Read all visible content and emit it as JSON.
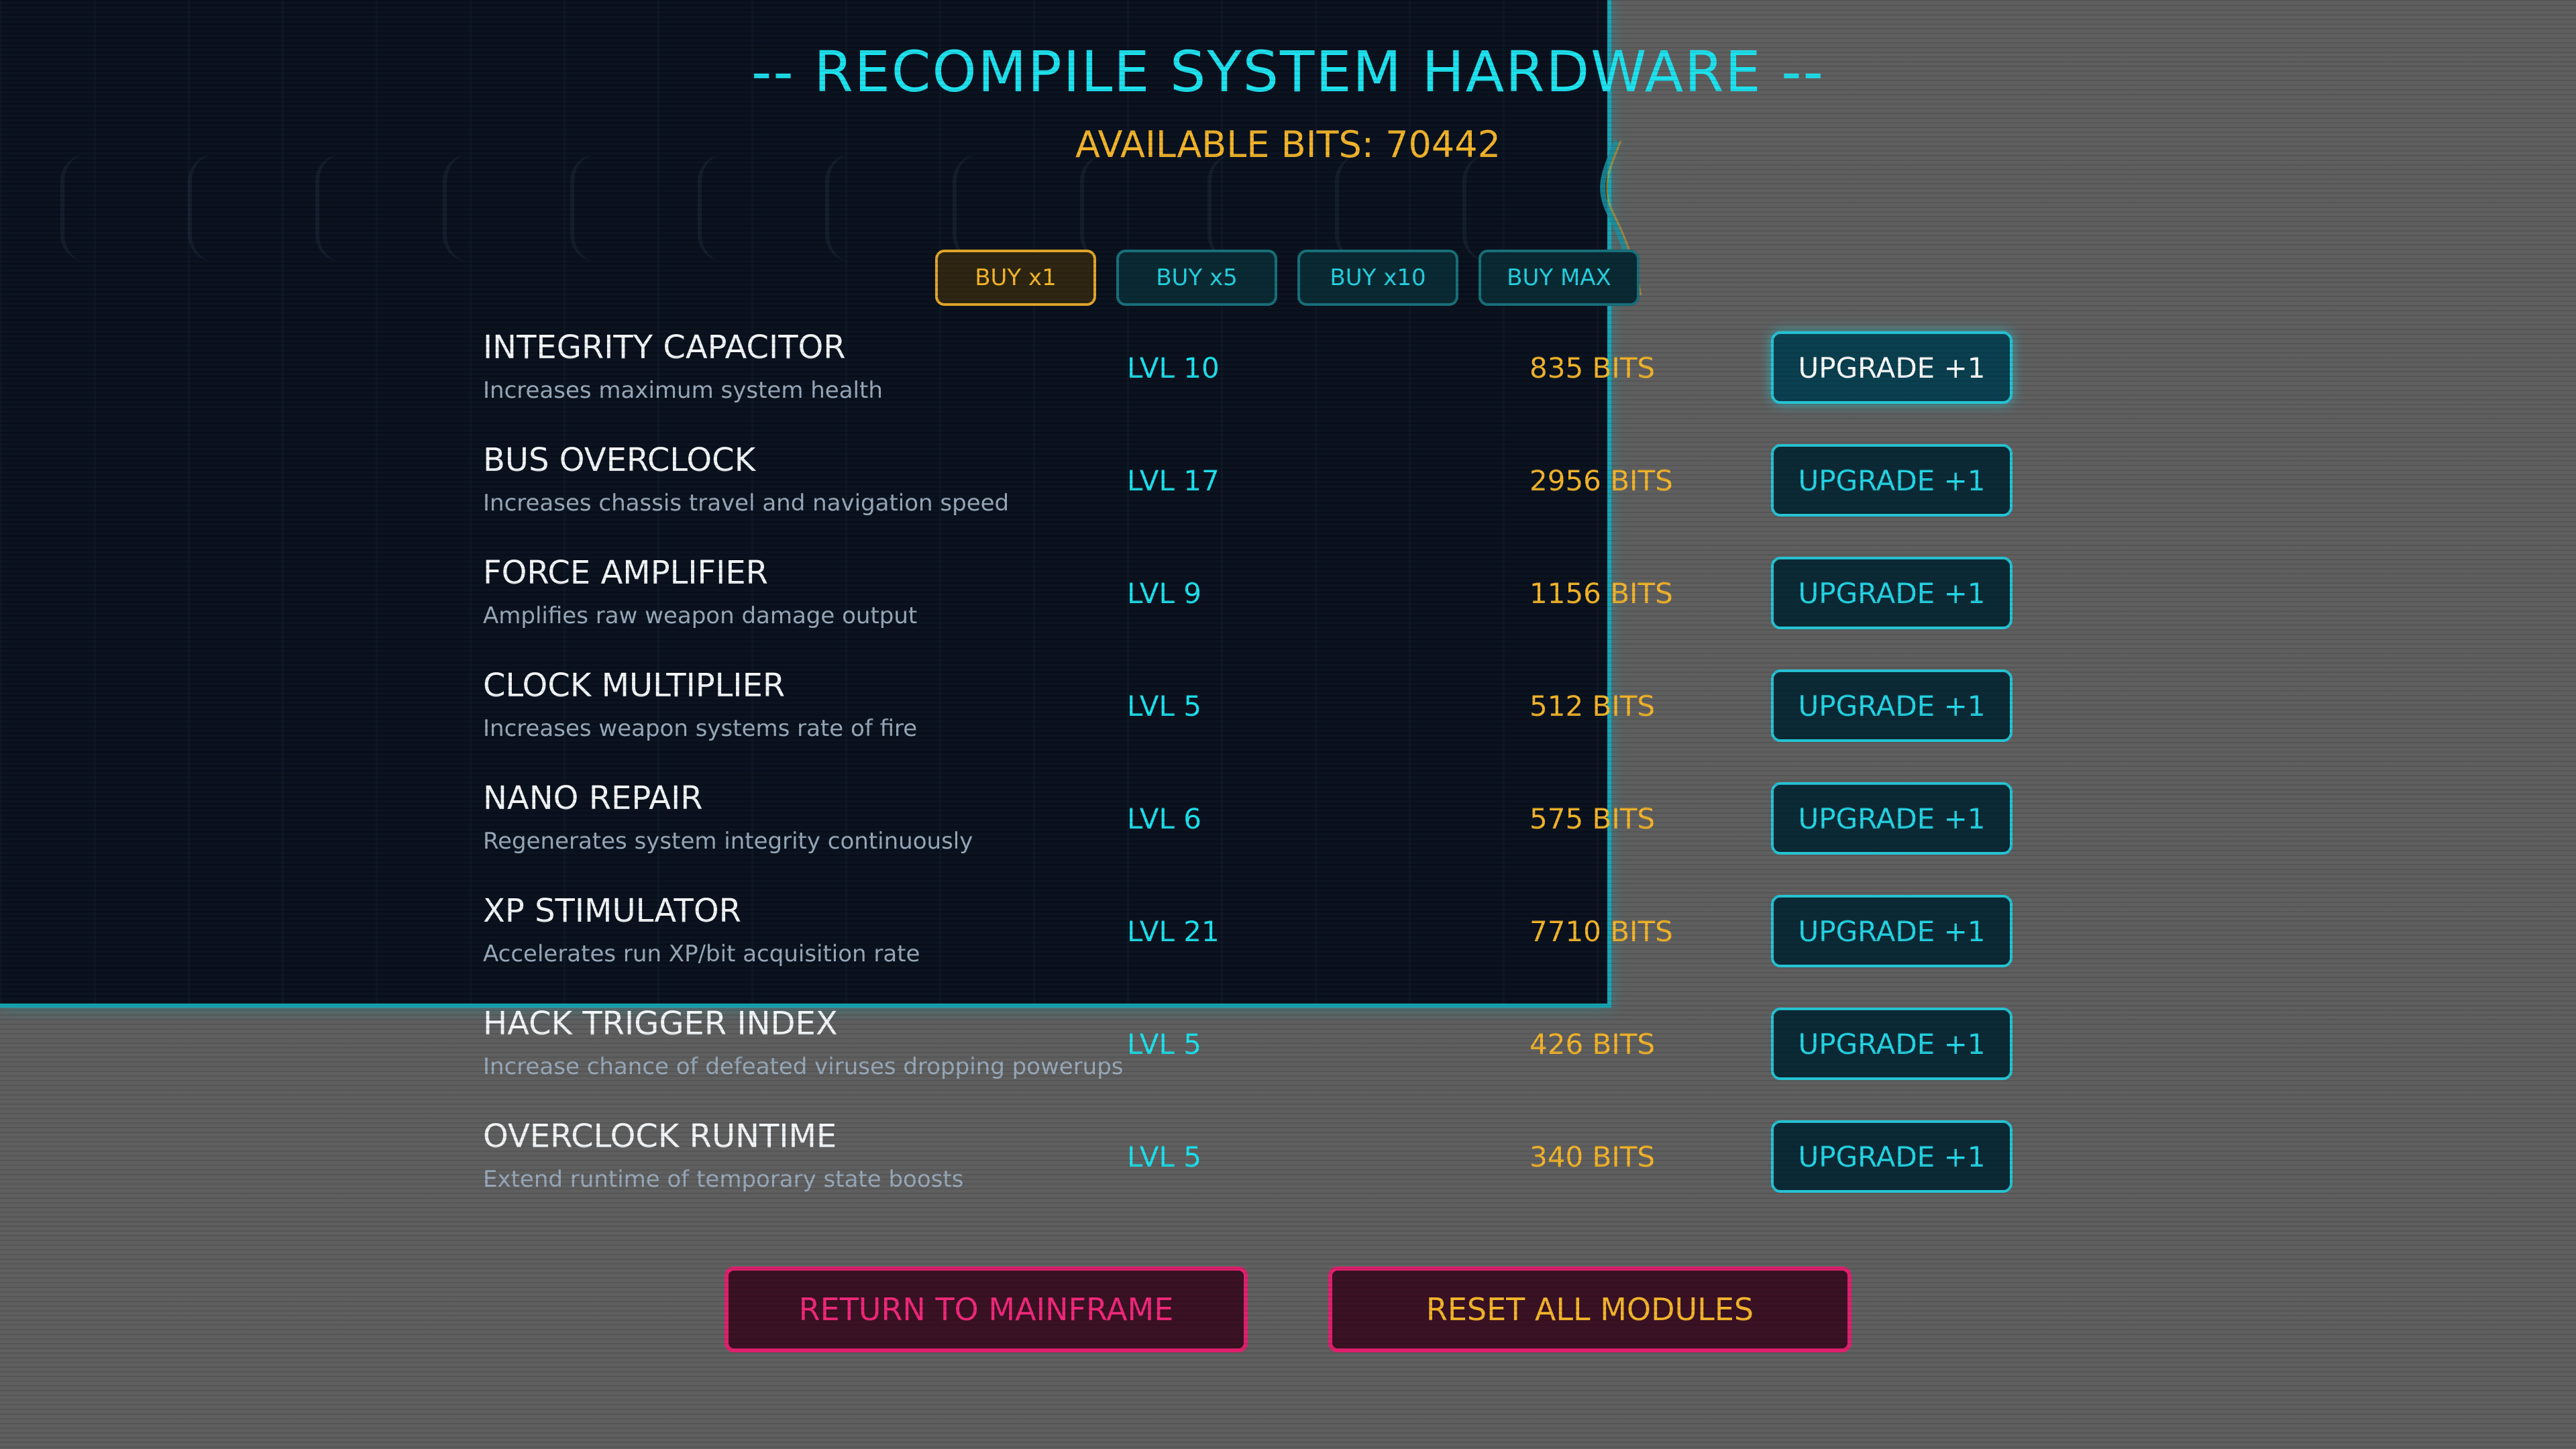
{
  "header": {
    "title": "-- RECOMPILE SYSTEM HARDWARE --",
    "available_bits_label": "AVAILABLE BITS: 70442"
  },
  "buy_modes": [
    {
      "label": "BUY x1",
      "selected": true
    },
    {
      "label": "BUY x5",
      "selected": false
    },
    {
      "label": "BUY x10",
      "selected": false
    },
    {
      "label": "BUY MAX",
      "selected": false
    }
  ],
  "upgrades": [
    {
      "name": "INTEGRITY CAPACITOR",
      "description": "Increases maximum system health",
      "level": "LVL 10",
      "cost": "835 BITS",
      "button": "UPGRADE +1"
    },
    {
      "name": "BUS OVERCLOCK",
      "description": "Increases chassis travel and navigation speed",
      "level": "LVL 17",
      "cost": "2956 BITS",
      "button": "UPGRADE +1"
    },
    {
      "name": "FORCE AMPLIFIER",
      "description": "Amplifies raw weapon damage output",
      "level": "LVL 9",
      "cost": "1156 BITS",
      "button": "UPGRADE +1"
    },
    {
      "name": "CLOCK MULTIPLIER",
      "description": "Increases weapon systems rate of fire",
      "level": "LVL 5",
      "cost": "512 BITS",
      "button": "UPGRADE +1"
    },
    {
      "name": "NANO REPAIR",
      "description": "Regenerates system integrity continuously",
      "level": "LVL 6",
      "cost": "575 BITS",
      "button": "UPGRADE +1"
    },
    {
      "name": "XP STIMULATOR",
      "description": "Accelerates run XP/bit acquisition rate",
      "level": "LVL 21",
      "cost": "7710 BITS",
      "button": "UPGRADE +1"
    },
    {
      "name": "HACK TRIGGER INDEX",
      "description": "Increase chance of defeated viruses dropping powerups",
      "level": "LVL 5",
      "cost": "426 BITS",
      "button": "UPGRADE +1"
    },
    {
      "name": "OVERCLOCK RUNTIME",
      "description": "Extend runtime of temporary state boosts",
      "level": "LVL 5",
      "cost": "340 BITS",
      "button": "UPGRADE +1"
    }
  ],
  "footer": {
    "return_label": "RETURN TO MAINFRAME",
    "reset_label": "RESET ALL MODULES"
  },
  "colors": {
    "accent_cyan": "#1ee2ee",
    "accent_gold": "#f4b52b",
    "accent_pink": "#e0206e"
  }
}
